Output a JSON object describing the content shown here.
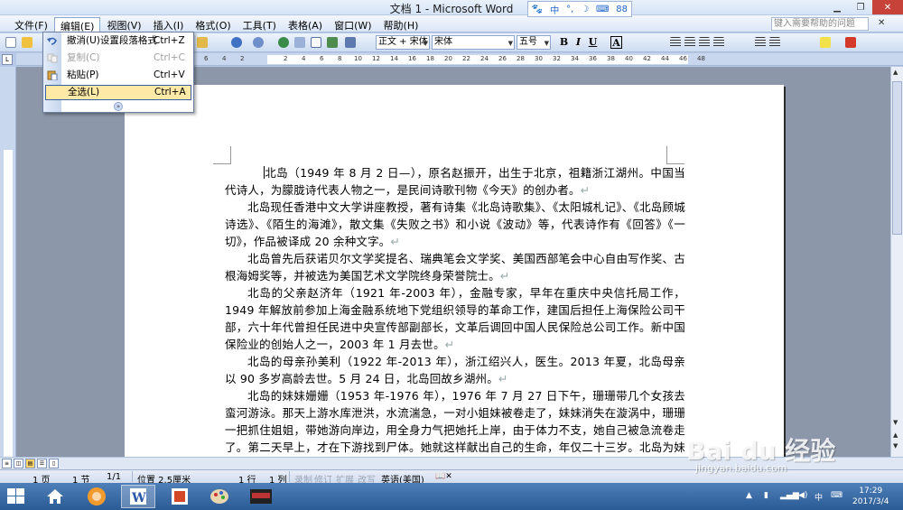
{
  "window": {
    "title": "文档 1 - Microsoft Word",
    "ime": [
      "中",
      "°,",
      "☽",
      "⌨",
      "88"
    ]
  },
  "menu": {
    "items": [
      "文件(F)",
      "编辑(E)",
      "视图(V)",
      "插入(I)",
      "格式(O)",
      "工具(T)",
      "表格(A)",
      "窗口(W)",
      "帮助(H)"
    ],
    "active_index": 1,
    "help_search_placeholder": "键入需要帮助的问题",
    "close_glyph": "✕"
  },
  "edit_menu": {
    "items": [
      {
        "label": "撤消(U)设置段落格式",
        "shortcut": "Ctrl+Z",
        "state": "normal"
      },
      {
        "label": "复制(C)",
        "shortcut": "Ctrl+C",
        "state": "disabled"
      },
      {
        "label": "粘贴(P)",
        "shortcut": "Ctrl+V",
        "state": "normal"
      },
      {
        "label": "全选(L)",
        "shortcut": "Ctrl+A",
        "state": "highlighted"
      }
    ],
    "expand_glyph": "»"
  },
  "toolbar": {
    "style": "正文 + 宋体",
    "font": "宋体",
    "size": "五号",
    "bold": "B",
    "italic": "I",
    "underline": "U",
    "char_border": "A"
  },
  "ruler": {
    "numbers": [
      "8",
      "6",
      "4",
      "2",
      "2",
      "4",
      "6",
      "8",
      "10",
      "12",
      "14",
      "16",
      "18",
      "20",
      "22",
      "24",
      "26",
      "28",
      "30",
      "32",
      "34",
      "36",
      "38",
      "40",
      "42",
      "44",
      "46",
      "48"
    ]
  },
  "document": {
    "paragraphs": [
      "北岛（1949 年 8 月 2 日—），原名赵振开，出生于北京，祖籍浙江湖州。中国当代诗人，为朦胧诗代表人物之一，是民间诗歌刊物《今天》的创办者。",
      "北岛现任香港中文大学讲座教授，著有诗集《北岛诗歌集》、《太阳城札记》、《北岛顾城诗选》、《陌生的海滩》，散文集《失败之书》和小说《波动》等，代表诗作有《回答》《一切》，作品被译成 20 余种文字。",
      "北岛曾先后获诺贝尔文学奖提名、瑞典笔会文学奖、美国西部笔会中心自由写作奖、古根海姆奖等，并被选为美国艺术文学院终身荣誉院士。",
      "北岛的父亲赵济年（1921 年-2003 年），金融专家，早年在重庆中央信托局工作，1949 年解放前参加上海金融系统地下党组织领导的革命工作，建国后担任上海保险公司干部，六十年代曾担任民进中央宣传部副部长，文革后调回中国人民保险总公司工作。新中国保险业的创始人之一，2003 年 1 月去世。",
      "北岛的母亲孙美利（1922 年-2013 年），浙江绍兴人，医生。2013 年夏，北岛母亲以 90 多岁高龄去世。5 月 24 日，北岛回故乡湖州。",
      "北岛的妹妹姗姗（1953 年-1976 年），1976 年 7 月 27 日下午，珊珊带几个女孩去蛮河游泳。那天上游水库泄洪，水流湍急，一对小姐妹被卷走了，妹妹消失在漩涡中，珊珊一把抓住姐姐，带她游向岸边，用全身力气把她托上岸，由于体力不支，她自己被急流卷走了。第二天早上，才在下游找到尸体。她就这样献出自己的生命，年仅二十三岁。北岛为妹妹写"
    ],
    "para_mark": "↵"
  },
  "statusbar": {
    "page": "1 页",
    "section": "1 节",
    "page_of": "1/1",
    "position": "位置 2.5厘米",
    "line": "1 行",
    "column": "1 列",
    "rec": "录制",
    "trk": "修订",
    "ext": "扩展",
    "ovr": "改写",
    "language": "英语(美国)"
  },
  "taskbar": {
    "tray_lang": "中",
    "time": "17:29",
    "date": "2017/3/4"
  },
  "watermark": {
    "main": "Bai du 经验",
    "sub": "jingyan.baidu.com"
  }
}
